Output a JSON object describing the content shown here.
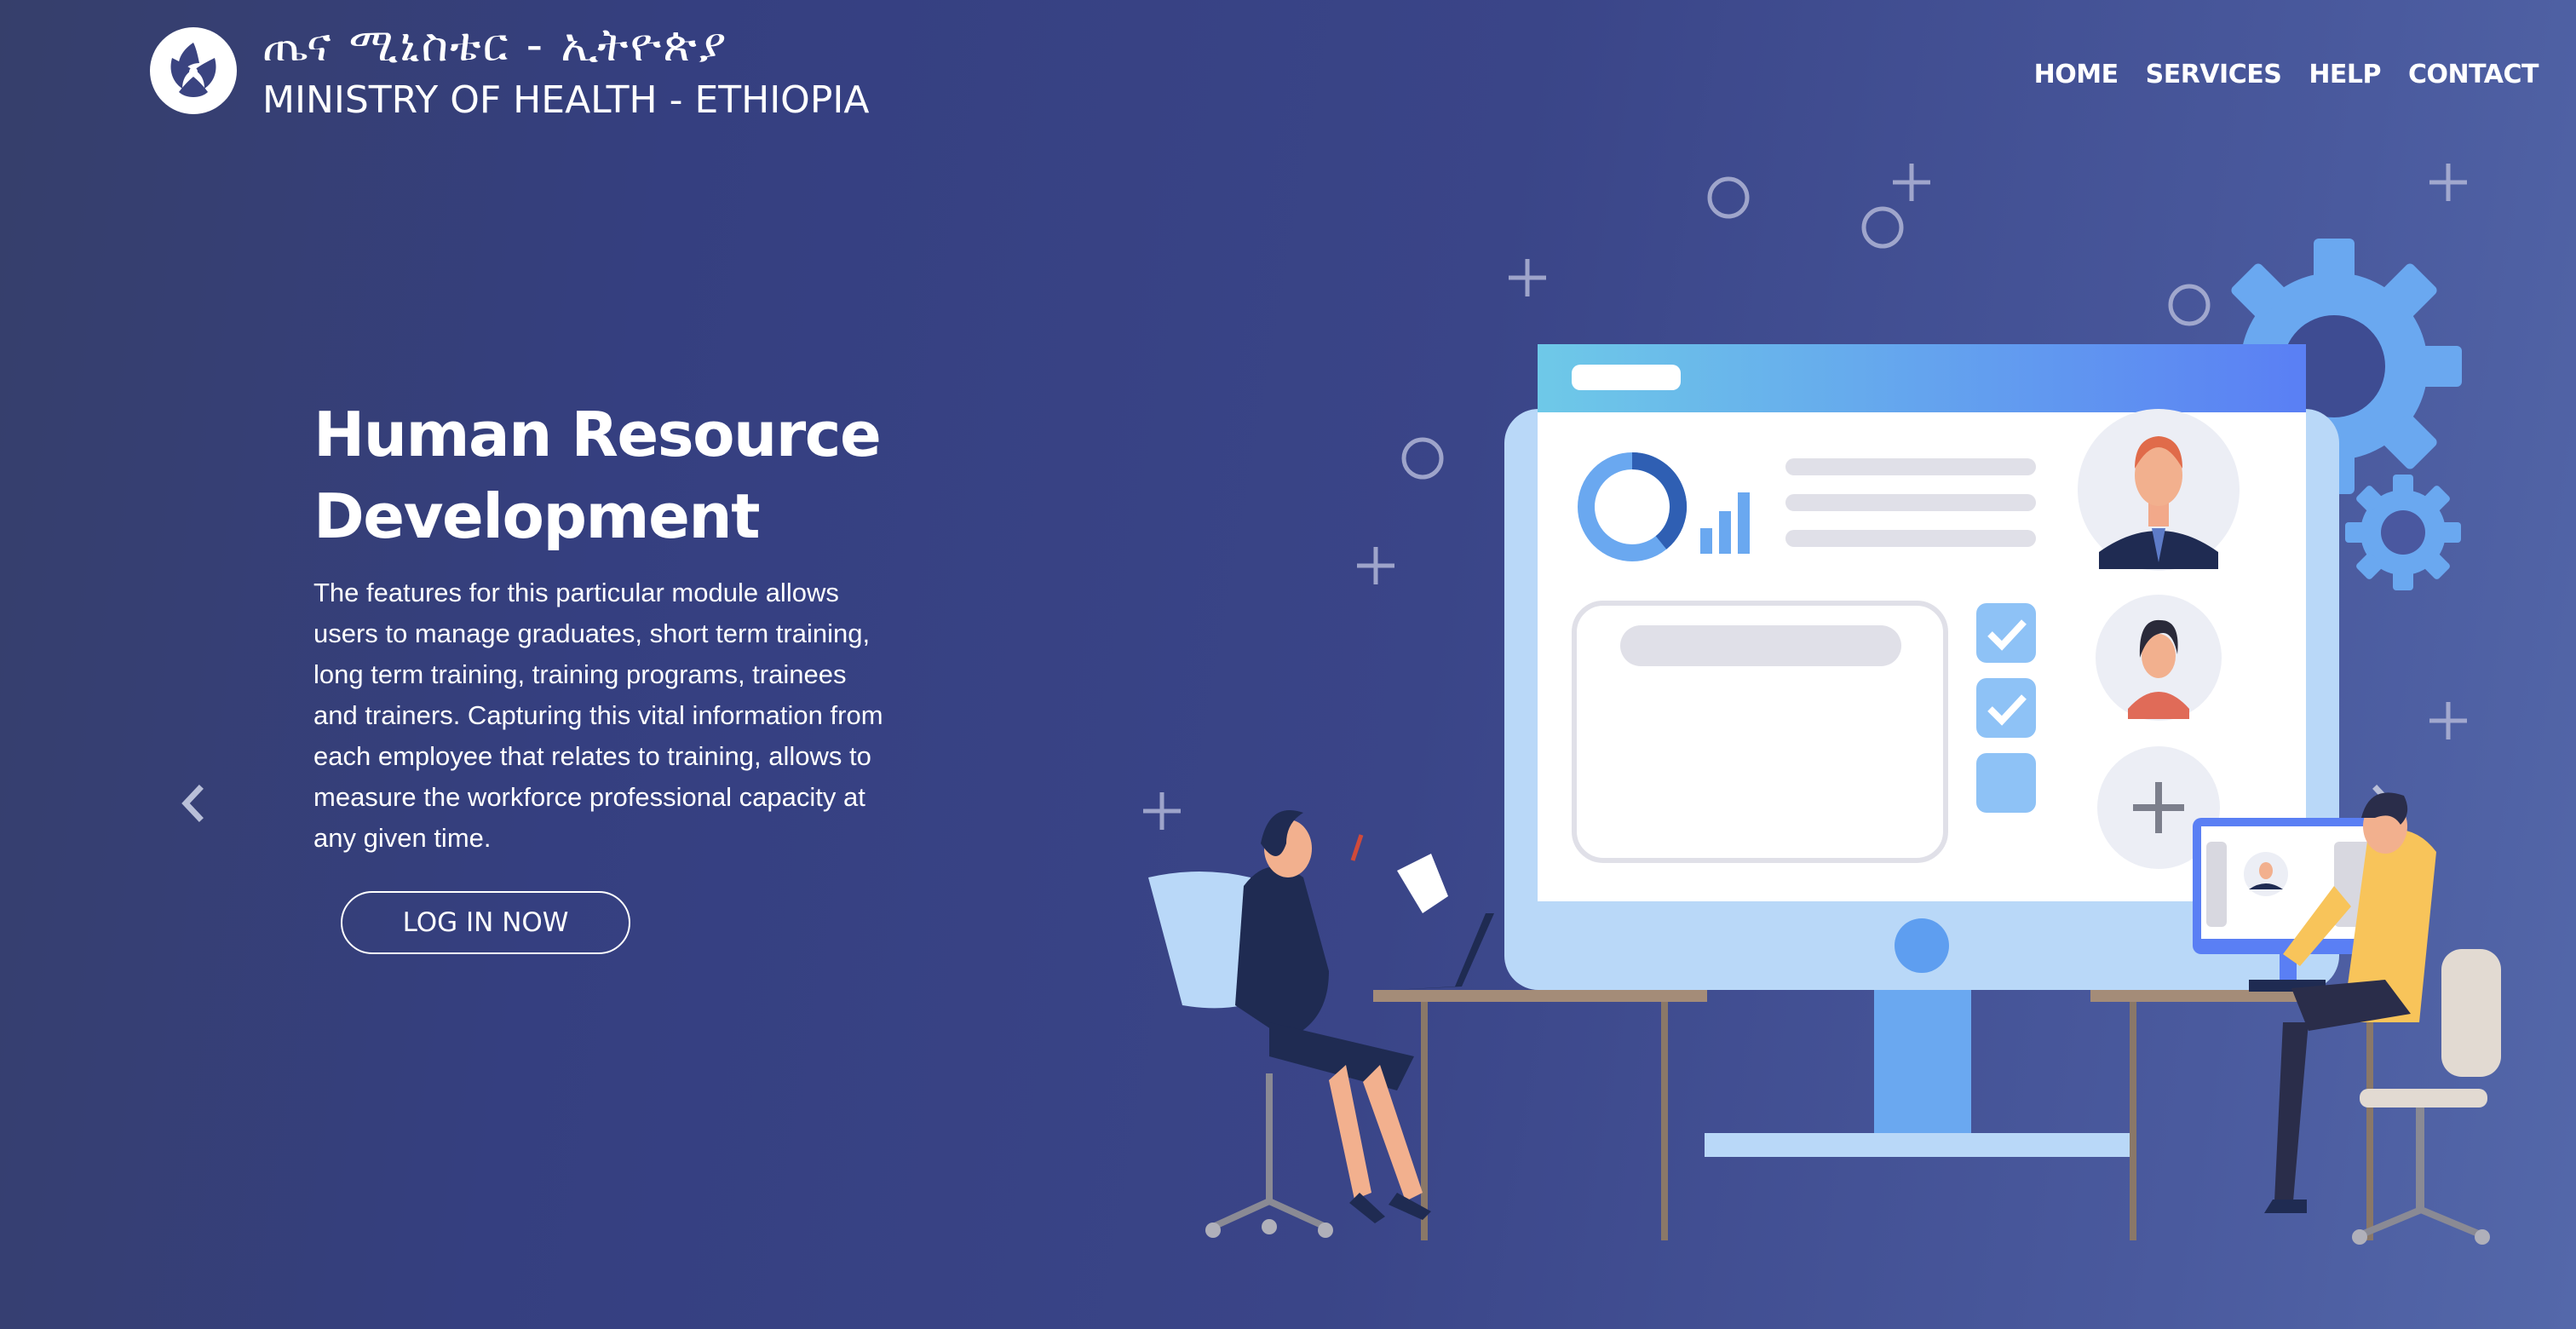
{
  "header": {
    "brand_amharic": "ጤና ሚኒስቴር - ኢትዮጵያ",
    "brand_english": "MINISTRY OF HEALTH - ETHIOPIA",
    "logo_icon": "ministry-logo-icon"
  },
  "nav": {
    "items": [
      {
        "label": "HOME"
      },
      {
        "label": "SERVICES"
      },
      {
        "label": "HELP"
      },
      {
        "label": "CONTACT"
      }
    ]
  },
  "hero": {
    "title_line1": "Human Resource",
    "title_line2": "Development",
    "description": "The features for this particular module allows users to manage graduates, short term training, long term training, training programs, trainees and trainers. Capturing this vital information from each employee that relates to training, allows to measure the workforce professional capacity at any given time.",
    "cta_label": "LOG IN NOW"
  },
  "carousel": {
    "prev_icon": "chevron-left-icon",
    "next_icon": "chevron-right-icon"
  },
  "colors": {
    "background_start": "#363f6b",
    "background_end": "#5468aa",
    "accent_blue": "#6aa8f0",
    "text": "#ffffff"
  }
}
